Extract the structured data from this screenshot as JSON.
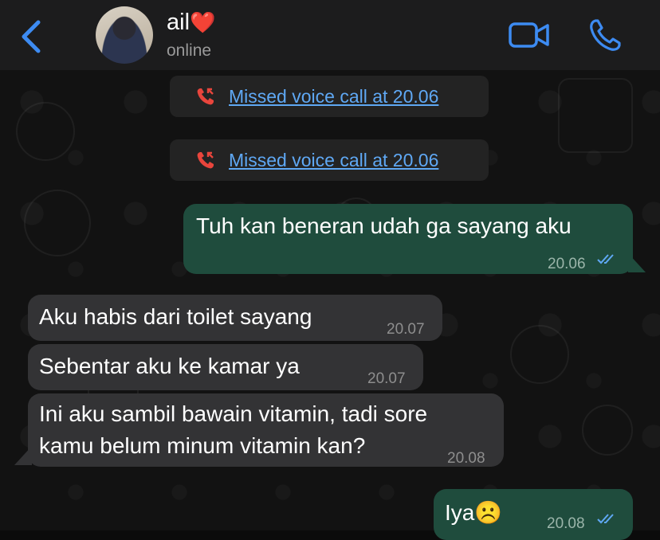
{
  "header": {
    "contact_name": "ail",
    "contact_emoji": "❤️",
    "status": "online",
    "colors": {
      "accent": "#3d8bf2",
      "heart": "#e0232e"
    }
  },
  "system_messages": [
    {
      "text": "Missed voice call at 20.06",
      "icon": "missed-call-icon"
    },
    {
      "text": "Missed voice call at 20.06",
      "icon": "missed-call-icon"
    }
  ],
  "messages": [
    {
      "direction": "outgoing",
      "text": "Tuh kan beneran udah ga sayang aku",
      "time": "20.06",
      "status": "read"
    },
    {
      "direction": "incoming",
      "text": "Aku habis dari toilet sayang",
      "time": "20.07"
    },
    {
      "direction": "incoming",
      "text": "Sebentar aku ke kamar ya",
      "time": "20.07"
    },
    {
      "direction": "incoming",
      "line1": "Ini aku sambil bawain vitamin, tadi sore",
      "line2": "kamu belum minum vitamin kan?",
      "time": "20.08"
    },
    {
      "direction": "outgoing",
      "text": "Iya",
      "emoji": "☹️",
      "time": "20.08",
      "status": "read"
    }
  ]
}
